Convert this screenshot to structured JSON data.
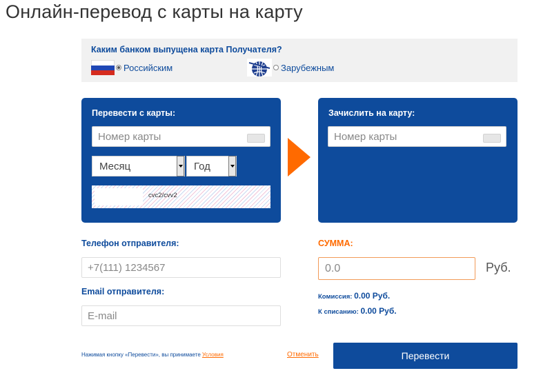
{
  "page": {
    "title": "Онлайн-перевод с карты на карту"
  },
  "bank_select": {
    "question": "Каким банком выпущена карта Получателя?",
    "options": [
      {
        "label": "Российским",
        "checked": true
      },
      {
        "label": "Зарубежным",
        "checked": false
      }
    ]
  },
  "from_card": {
    "title": "Перевести с карты:",
    "number_placeholder": "Номер карты",
    "month_value": "Месяц",
    "year_value": "Год",
    "cvc_label": "cvc2/cvv2"
  },
  "to_card": {
    "title": "Зачислить на карту:",
    "number_placeholder": "Номер карты"
  },
  "sender": {
    "phone_label": "Телефон отправителя:",
    "phone_placeholder": "+7(111) 1234567",
    "email_label": "Email отправителя:",
    "email_placeholder": "E-mail"
  },
  "amount": {
    "label": "СУММА:",
    "placeholder": "0.0",
    "currency": "Руб.",
    "commission_label": "Комиссия:",
    "commission_value": "0.00 Руб.",
    "debit_label": "К списанию:",
    "debit_value": "0.00 Руб."
  },
  "footer": {
    "terms_text": "Нажимая кнопку «Перевести», вы принимаете",
    "terms_link": "Условия",
    "cancel": "Отменить",
    "submit": "Перевести"
  },
  "colors": {
    "brand_blue": "#0e4b9c",
    "accent_orange": "#ff6a00",
    "panel_gray": "#f1f1f1"
  }
}
